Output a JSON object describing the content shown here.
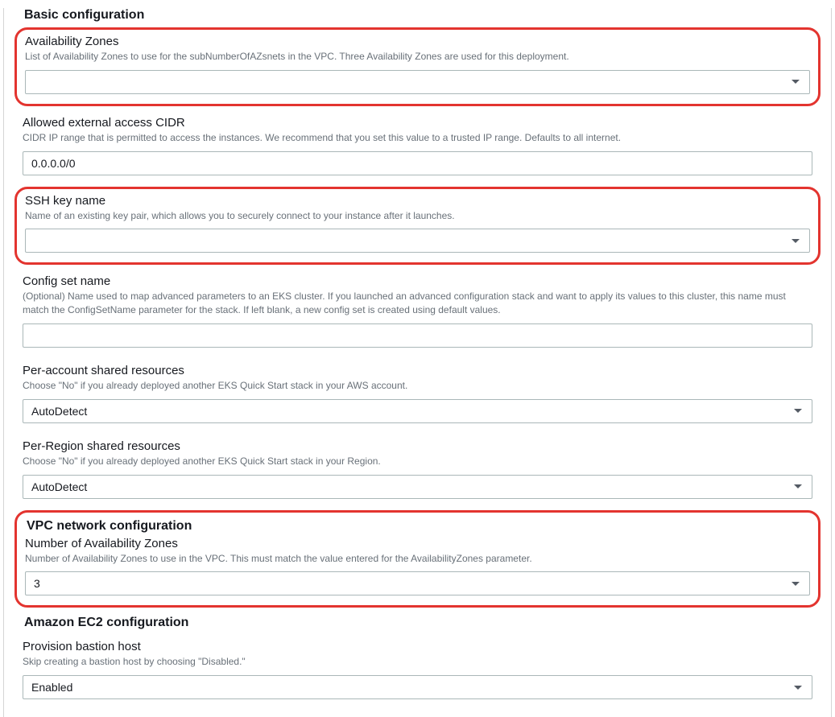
{
  "sections": {
    "basic": {
      "title": "Basic configuration",
      "az": {
        "label": "Availability Zones",
        "desc": "List of Availability Zones to use for the subNumberOfAZsnets in the VPC. Three Availability Zones are used for this deployment.",
        "value": ""
      },
      "cidr": {
        "label": "Allowed external access CIDR",
        "desc": "CIDR IP range that is permitted to access the instances. We recommend that you set this value to a trusted IP range. Defaults to all internet.",
        "value": "0.0.0.0/0"
      },
      "ssh": {
        "label": "SSH key name",
        "desc": "Name of an existing key pair, which allows you to securely connect to your instance after it launches.",
        "value": ""
      },
      "configset": {
        "label": "Config set name",
        "desc": "(Optional) Name used to map advanced parameters to an EKS cluster. If you launched an advanced configuration stack and want to apply its values to this cluster, this name must match the ConfigSetName parameter for the stack. If left blank, a new config set is created using default values.",
        "value": ""
      },
      "perAccount": {
        "label": "Per-account shared resources",
        "desc": "Choose \"No\" if you already deployed another EKS Quick Start stack in your AWS account.",
        "value": "AutoDetect"
      },
      "perRegion": {
        "label": "Per-Region shared resources",
        "desc": "Choose \"No\" if you already deployed another EKS Quick Start stack in your Region.",
        "value": "AutoDetect"
      }
    },
    "vpc": {
      "title": "VPC network configuration",
      "numAz": {
        "label": "Number of Availability Zones",
        "desc": "Number of Availability Zones to use in the VPC. This must match the value entered for the AvailabilityZones parameter.",
        "value": "3"
      }
    },
    "ec2": {
      "title": "Amazon EC2 configuration",
      "bastion": {
        "label": "Provision bastion host",
        "desc": "Skip creating a bastion host by choosing \"Disabled.\"",
        "value": "Enabled"
      }
    }
  }
}
